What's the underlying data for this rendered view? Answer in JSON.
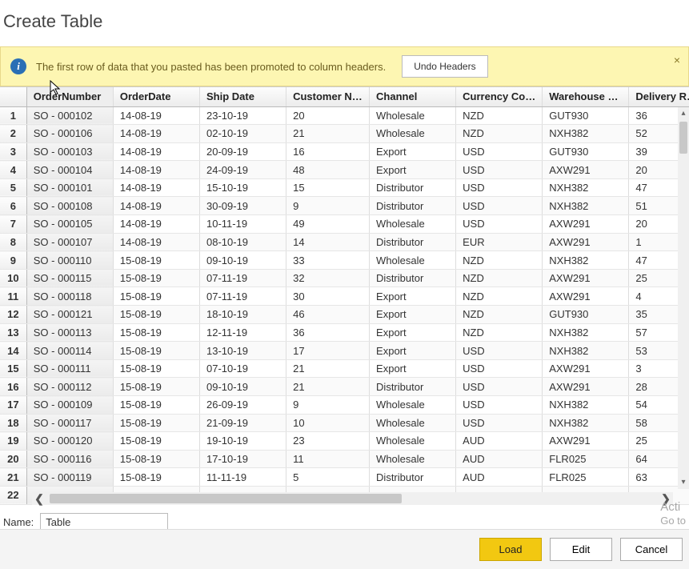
{
  "title": "Create Table",
  "banner": {
    "text": "The first row of data that you pasted has been promoted to column headers.",
    "undo_label": "Undo Headers",
    "close_glyph": "×"
  },
  "columns": [
    "OrderNumber",
    "OrderDate",
    "Ship Date",
    "Customer Na...",
    "Channel",
    "Currency Code",
    "Warehouse C...",
    "Delivery Regi.."
  ],
  "rows": [
    {
      "n": 1,
      "c": [
        "SO - 000102",
        "14-08-19",
        "23-10-19",
        "20",
        "Wholesale",
        "NZD",
        "GUT930",
        "36"
      ]
    },
    {
      "n": 2,
      "c": [
        "SO - 000106",
        "14-08-19",
        "02-10-19",
        "21",
        "Wholesale",
        "NZD",
        "NXH382",
        "52"
      ]
    },
    {
      "n": 3,
      "c": [
        "SO - 000103",
        "14-08-19",
        "20-09-19",
        "16",
        "Export",
        "USD",
        "GUT930",
        "39"
      ]
    },
    {
      "n": 4,
      "c": [
        "SO - 000104",
        "14-08-19",
        "24-09-19",
        "48",
        "Export",
        "USD",
        "AXW291",
        "20"
      ]
    },
    {
      "n": 5,
      "c": [
        "SO - 000101",
        "14-08-19",
        "15-10-19",
        "15",
        "Distributor",
        "USD",
        "NXH382",
        "47"
      ]
    },
    {
      "n": 6,
      "c": [
        "SO - 000108",
        "14-08-19",
        "30-09-19",
        "9",
        "Distributor",
        "USD",
        "NXH382",
        "51"
      ]
    },
    {
      "n": 7,
      "c": [
        "SO - 000105",
        "14-08-19",
        "10-11-19",
        "49",
        "Wholesale",
        "USD",
        "AXW291",
        "20"
      ]
    },
    {
      "n": 8,
      "c": [
        "SO - 000107",
        "14-08-19",
        "08-10-19",
        "14",
        "Distributor",
        "EUR",
        "AXW291",
        "1"
      ]
    },
    {
      "n": 9,
      "c": [
        "SO - 000110",
        "15-08-19",
        "09-10-19",
        "33",
        "Wholesale",
        "NZD",
        "NXH382",
        "47"
      ]
    },
    {
      "n": 10,
      "c": [
        "SO - 000115",
        "15-08-19",
        "07-11-19",
        "32",
        "Distributor",
        "NZD",
        "AXW291",
        "25"
      ]
    },
    {
      "n": 11,
      "c": [
        "SO - 000118",
        "15-08-19",
        "07-11-19",
        "30",
        "Export",
        "NZD",
        "AXW291",
        "4"
      ]
    },
    {
      "n": 12,
      "c": [
        "SO - 000121",
        "15-08-19",
        "18-10-19",
        "46",
        "Export",
        "NZD",
        "GUT930",
        "35"
      ]
    },
    {
      "n": 13,
      "c": [
        "SO - 000113",
        "15-08-19",
        "12-11-19",
        "36",
        "Export",
        "NZD",
        "NXH382",
        "57"
      ]
    },
    {
      "n": 14,
      "c": [
        "SO - 000114",
        "15-08-19",
        "13-10-19",
        "17",
        "Export",
        "USD",
        "NXH382",
        "53"
      ]
    },
    {
      "n": 15,
      "c": [
        "SO - 000111",
        "15-08-19",
        "07-10-19",
        "21",
        "Export",
        "USD",
        "AXW291",
        "3"
      ]
    },
    {
      "n": 16,
      "c": [
        "SO - 000112",
        "15-08-19",
        "09-10-19",
        "21",
        "Distributor",
        "USD",
        "AXW291",
        "28"
      ]
    },
    {
      "n": 17,
      "c": [
        "SO - 000109",
        "15-08-19",
        "26-09-19",
        "9",
        "Wholesale",
        "USD",
        "NXH382",
        "54"
      ]
    },
    {
      "n": 18,
      "c": [
        "SO - 000117",
        "15-08-19",
        "21-09-19",
        "10",
        "Wholesale",
        "USD",
        "NXH382",
        "58"
      ]
    },
    {
      "n": 19,
      "c": [
        "SO - 000120",
        "15-08-19",
        "19-10-19",
        "23",
        "Wholesale",
        "AUD",
        "AXW291",
        "25"
      ]
    },
    {
      "n": 20,
      "c": [
        "SO - 000116",
        "15-08-19",
        "17-10-19",
        "11",
        "Wholesale",
        "AUD",
        "FLR025",
        "64"
      ]
    },
    {
      "n": 21,
      "c": [
        "SO - 000119",
        "15-08-19",
        "11-11-19",
        "5",
        "Distributor",
        "AUD",
        "FLR025",
        "63"
      ]
    },
    {
      "n": 22,
      "c": [
        "",
        "",
        "",
        "",
        "",
        "",
        "",
        ""
      ]
    }
  ],
  "name_field": {
    "label": "Name:",
    "value": "Table"
  },
  "watermark": {
    "line1": "Acti",
    "line2": "Go to"
  },
  "buttons": {
    "load": "Load",
    "edit": "Edit",
    "cancel": "Cancel"
  },
  "info_glyph": "i",
  "scroll": {
    "up": "▴",
    "down": "▾",
    "left": "❮",
    "right": "❯"
  }
}
